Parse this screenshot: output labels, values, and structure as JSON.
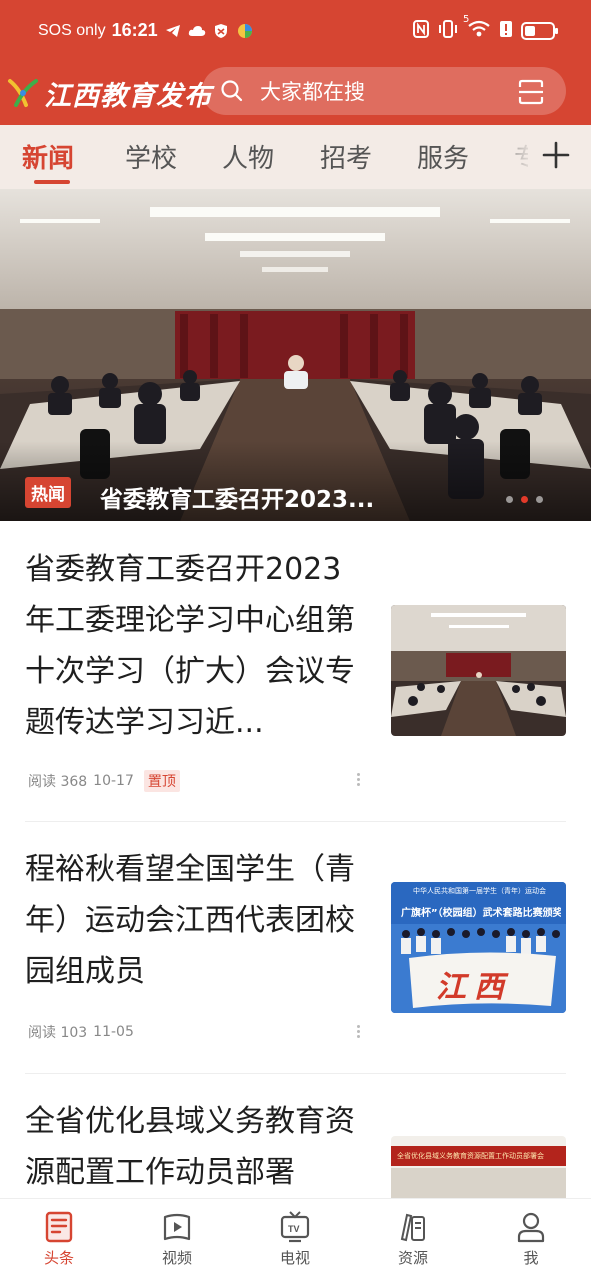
{
  "status_bar": {
    "network": "SOS only",
    "time": "16:21",
    "network_badge": "5"
  },
  "header": {
    "logo_text": "江西教育发布",
    "search_placeholder": "大家都在搜"
  },
  "tabs": [
    {
      "label": "新闻",
      "active": true
    },
    {
      "label": "学校",
      "active": false
    },
    {
      "label": "人物",
      "active": false
    },
    {
      "label": "招考",
      "active": false
    },
    {
      "label": "服务",
      "active": false
    },
    {
      "label": "专",
      "active": false
    }
  ],
  "banner": {
    "tag": "热闻",
    "title": "省委教育工委召开2023...",
    "slide_count": 3,
    "active_slide": 2
  },
  "articles": [
    {
      "title": "省委教育工委召开2023年工委理论学习中心组第十次学习（扩大）会议专题传达学习习近...",
      "reads": "阅读 368",
      "date": "10-17",
      "badge": "置顶"
    },
    {
      "title": "程裕秋看望全国学生（青年）运动会江西代表团校园组成员",
      "reads": "阅读 103",
      "date": "11-05",
      "badge": "",
      "thumb_text_1": "中华人民共和国第一届学生（青年）运动会",
      "thumb_text_2": "广旗杯”（校园组）武术套路比赛颁奖仪式",
      "thumb_banner": "江西"
    },
    {
      "title": "全省优化县域义务教育资源配置工作动员部署",
      "thumb_text": "全省优化县域义务教育资源配置工作动员部署会"
    }
  ],
  "bottom_nav": [
    {
      "label": "头条",
      "icon": "news-icon",
      "active": true
    },
    {
      "label": "视频",
      "icon": "video-icon",
      "active": false
    },
    {
      "label": "电视",
      "icon": "tv-icon",
      "active": false
    },
    {
      "label": "资源",
      "icon": "resources-icon",
      "active": false
    },
    {
      "label": "我",
      "icon": "profile-icon",
      "active": false
    }
  ],
  "colors": {
    "brand": "#d64532",
    "tab_bar_bg": "#f3ebe6"
  }
}
